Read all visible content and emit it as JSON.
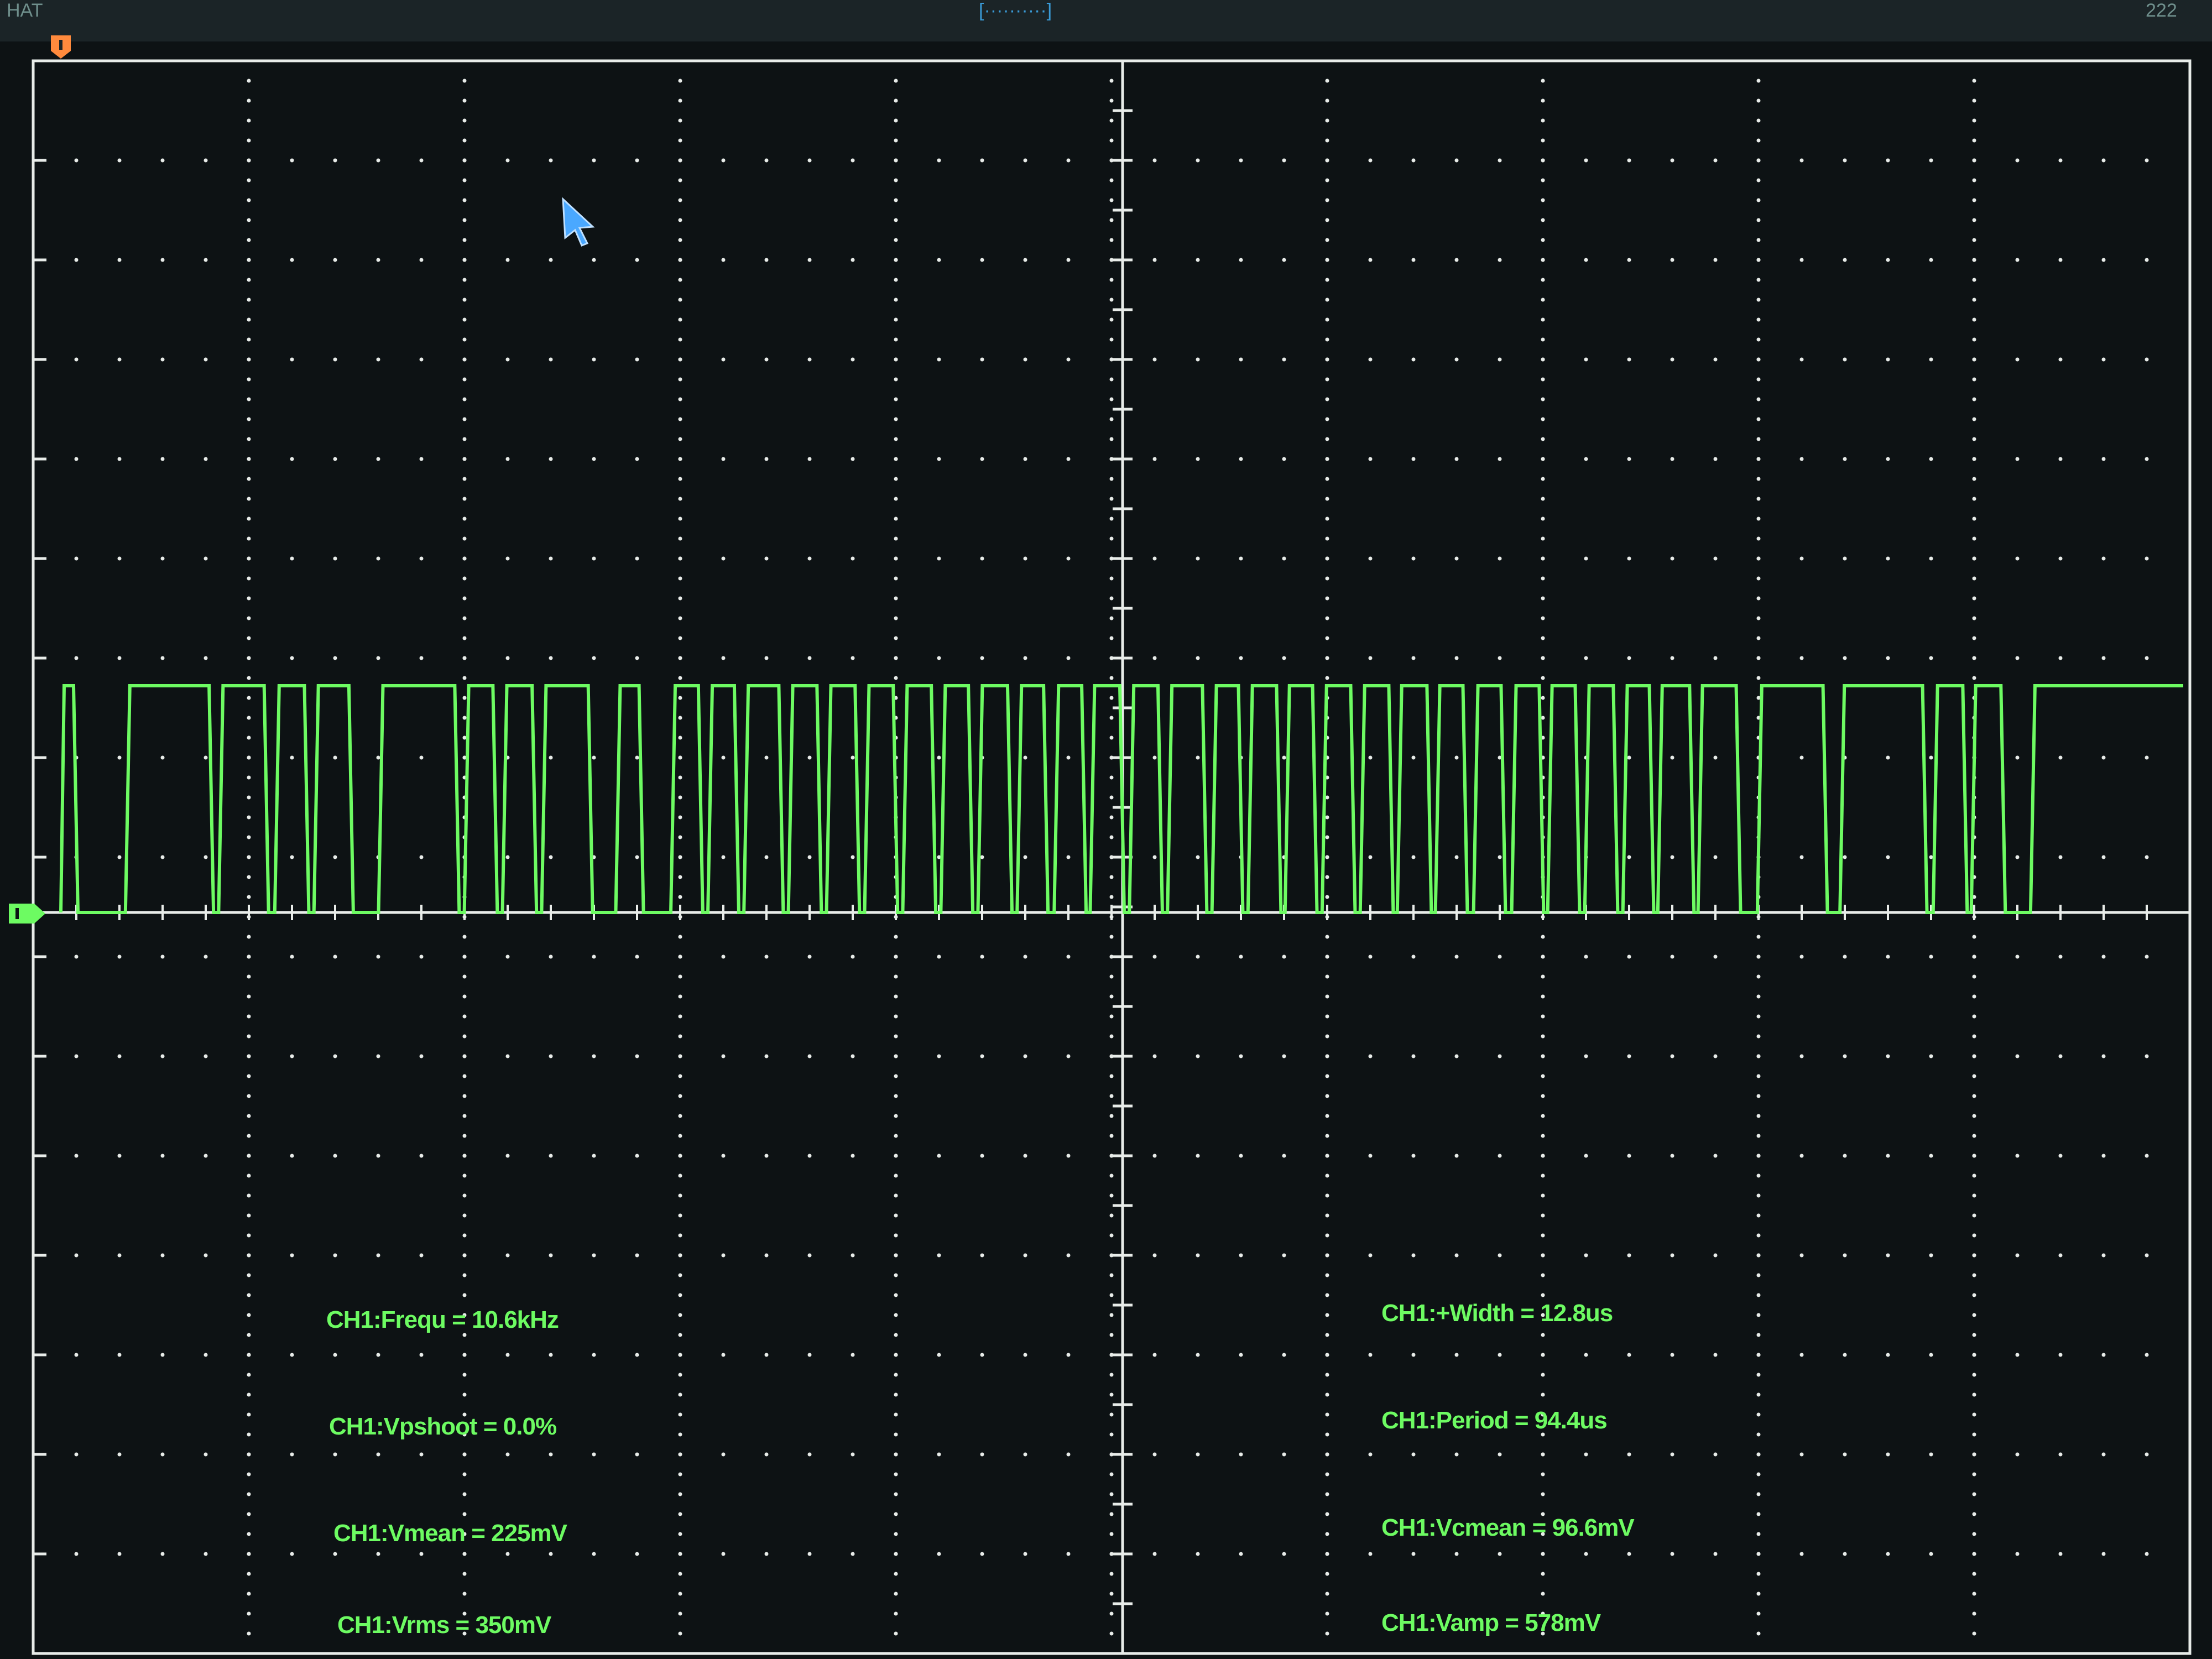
{
  "header": {
    "left_label": "HAT",
    "center_label": "[··········]",
    "right_label": "222"
  },
  "icons": {
    "trigger_position": "trigger-position-marker-icon",
    "channel_ground": "ch1-ground-marker-icon",
    "cursor": "mouse-pointer-icon"
  },
  "colors": {
    "background": "#0d1214",
    "trace": "#6dfb62",
    "graticule": "#e8ece9",
    "trigger": "#ff8a3d"
  },
  "chart_data": {
    "type": "line",
    "title": "",
    "xlabel": "",
    "ylabel": "",
    "grid": true,
    "grid_divisions": {
      "x": 10,
      "y": 16
    },
    "baseline_division": -1,
    "high_division": 1,
    "segments": [
      [
        0.0,
        1
      ],
      [
        0.6,
        0
      ],
      [
        3.05,
        1
      ],
      [
        7.0,
        0
      ],
      [
        7.45,
        1
      ],
      [
        9.6,
        0
      ],
      [
        10.1,
        1
      ],
      [
        11.5,
        0
      ],
      [
        11.95,
        1
      ],
      [
        13.6,
        0
      ],
      [
        15.0,
        1
      ],
      [
        18.6,
        0
      ],
      [
        19.05,
        1
      ],
      [
        20.4,
        0
      ],
      [
        20.85,
        1
      ],
      [
        22.25,
        0
      ],
      [
        22.7,
        1
      ],
      [
        24.9,
        0
      ],
      [
        26.2,
        1
      ],
      [
        27.3,
        0
      ],
      [
        28.8,
        1
      ],
      [
        30.1,
        0
      ],
      [
        30.55,
        1
      ],
      [
        31.8,
        0
      ],
      [
        32.25,
        1
      ],
      [
        33.9,
        0
      ],
      [
        34.35,
        1
      ],
      [
        35.7,
        0
      ],
      [
        36.15,
        1
      ],
      [
        37.5,
        0
      ],
      [
        37.95,
        1
      ],
      [
        39.3,
        0
      ],
      [
        39.75,
        1
      ],
      [
        41.1,
        0
      ],
      [
        41.55,
        1
      ],
      [
        42.85,
        0
      ],
      [
        43.3,
        1
      ],
      [
        44.7,
        0
      ],
      [
        45.15,
        1
      ],
      [
        46.4,
        0
      ],
      [
        46.9,
        1
      ],
      [
        48.2,
        0
      ],
      [
        48.6,
        1
      ],
      [
        50.0,
        0
      ],
      [
        50.45,
        1
      ],
      [
        51.8,
        0
      ],
      [
        52.25,
        1
      ],
      [
        53.9,
        0
      ],
      [
        54.35,
        1
      ],
      [
        55.6,
        0
      ],
      [
        56.05,
        1
      ],
      [
        57.4,
        0
      ],
      [
        57.8,
        1
      ],
      [
        59.1,
        0
      ],
      [
        59.55,
        1
      ],
      [
        60.9,
        0
      ],
      [
        61.35,
        1
      ],
      [
        62.7,
        0
      ],
      [
        63.1,
        1
      ],
      [
        64.5,
        0
      ],
      [
        64.9,
        1
      ],
      [
        66.2,
        0
      ],
      [
        66.7,
        1
      ],
      [
        68.0,
        0
      ],
      [
        68.5,
        1
      ],
      [
        69.8,
        0
      ],
      [
        70.2,
        1
      ],
      [
        71.5,
        0
      ],
      [
        71.95,
        1
      ],
      [
        73.3,
        0
      ],
      [
        73.75,
        1
      ],
      [
        75.0,
        0
      ],
      [
        75.4,
        1
      ],
      [
        76.9,
        0
      ],
      [
        77.3,
        1
      ],
      [
        79.1,
        0
      ],
      [
        80.1,
        1
      ],
      [
        83.2,
        0
      ],
      [
        84.0,
        1
      ],
      [
        87.9,
        0
      ],
      [
        88.4,
        1
      ],
      [
        89.8,
        0
      ],
      [
        90.2,
        1
      ],
      [
        91.6,
        0
      ],
      [
        93.0,
        1
      ],
      [
        100.0,
        1
      ]
    ]
  },
  "measurements": {
    "left": [
      {
        "label": "CH1:Frequ = 10.6kHz"
      },
      {
        "label": "CH1:Vpshoot = 0.0%"
      },
      {
        "label": "CH1:Vmean = 225mV"
      },
      {
        "label": "CH1:Vrms = 350mV"
      }
    ],
    "right": [
      {
        "label": "CH1:+Width = 12.8us"
      },
      {
        "label": "CH1:Period = 94.4us"
      },
      {
        "label": "CH1:Vcmean = 96.6mV"
      },
      {
        "label": "CH1:Vamp = 578mV"
      }
    ]
  }
}
